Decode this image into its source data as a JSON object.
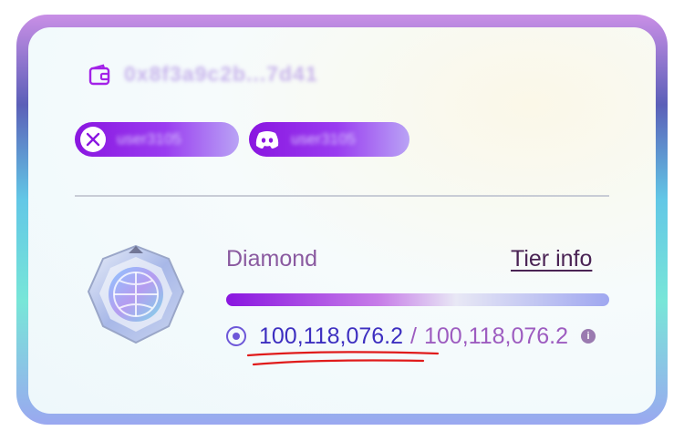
{
  "profile": {
    "address_blurred": "0x8f3a9c2b...7d41",
    "twitter_handle_blurred": "user3105",
    "discord_handle_blurred": "user3105"
  },
  "tier": {
    "name": "Diamond",
    "info_link": "Tier info",
    "progress_fraction": 1.0,
    "points": "100,118,076.2",
    "separator": "/",
    "total": "100,118,076.2"
  },
  "icons": [
    "wallet-icon",
    "x-twitter-icon",
    "discord-icon",
    "diamond-badge-icon",
    "points-coin-icon",
    "info-icon"
  ],
  "colors": {
    "accent": "#8a16e0",
    "tier_text": "#8a5aa0",
    "points": "#3d2fc0",
    "annotation": "#e01b1b"
  }
}
